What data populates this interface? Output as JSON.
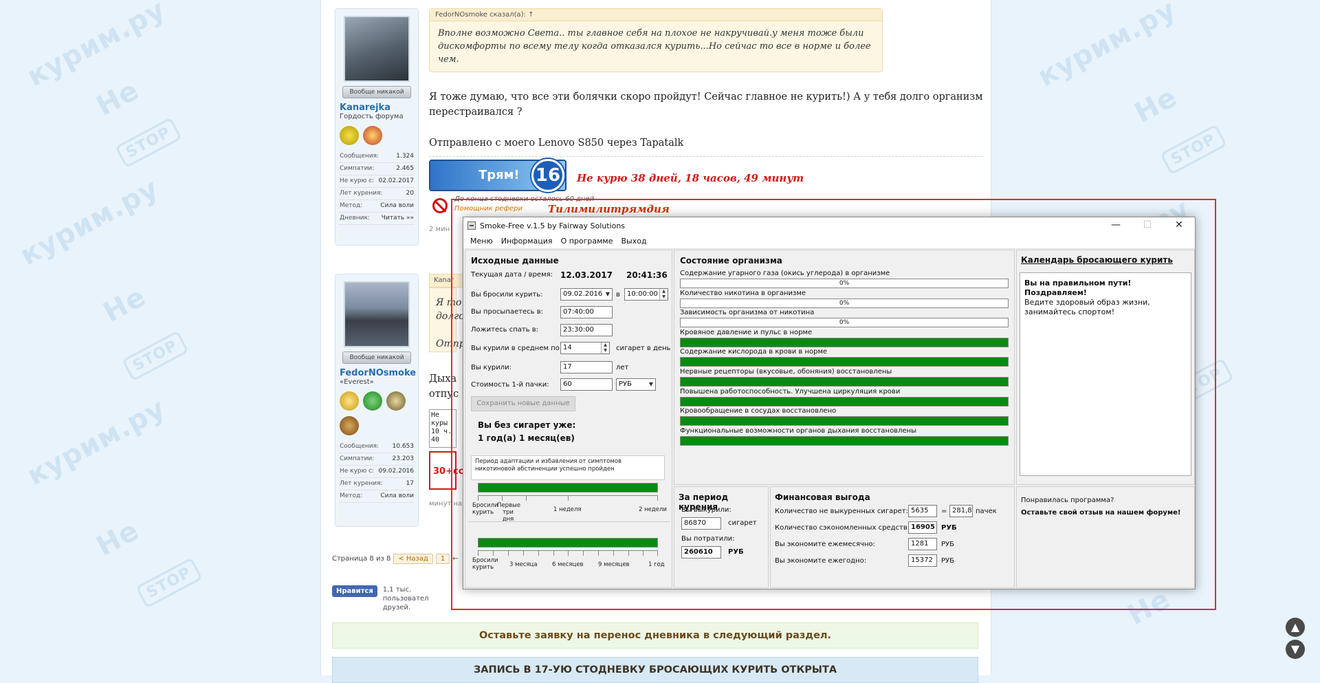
{
  "forum": {
    "post1": {
      "user_name": "Kanarejka",
      "user_title": "Гордость форума",
      "status_button": "Вообще никакой",
      "stats": [
        {
          "label": "Сообщения:",
          "value": "1.324"
        },
        {
          "label": "Симпатии:",
          "value": "2.465"
        },
        {
          "label": "Не курю с:",
          "value": "02.02.2017"
        },
        {
          "label": "Лет курения:",
          "value": "20"
        },
        {
          "label": "Метод:",
          "value": "Сила воли"
        },
        {
          "label": "Дневник:",
          "value": "Читать »»"
        }
      ],
      "quote_head": "FedorNOsmoke сказал(а): ↑",
      "quote_text": "Вполне возможно Света.. ты главное себя на плохое не накручивай.у меня тоже были дискомфорты по всему телу когда отказался курить...Но сейчас то все в норме и более чем.",
      "text": "Я тоже думаю, что все эти болячки скоро пройдут! Сейчас главное не курить!) А у тебя долго организм перестраивался ?",
      "sent_from": "Отправлено с моего Lenovo S850 через Tapatalk",
      "sig_banner": "Трям!",
      "sig_badge": "16",
      "sig_text": "Не курю  38 дней, 18 часов, 49 минут",
      "sig_line2": "До конца стодневки осталось 60 дней",
      "sig_line3": "Помощник рефери",
      "sig_line4": "Тилимилитрямдия",
      "time_ago": "2 мин"
    },
    "post2": {
      "user_name": "FedorNOsmoke",
      "user_title": "«Everest»",
      "status_button": "Вообще никакой",
      "stats": [
        {
          "label": "Сообщения:",
          "value": "10.653"
        },
        {
          "label": "Симпатии:",
          "value": "23.203"
        },
        {
          "label": "Не курю с:",
          "value": "09.02.2016"
        },
        {
          "label": "Лет курения:",
          "value": "17"
        },
        {
          "label": "Метод:",
          "value": "Сила воли"
        }
      ],
      "quote_head": "Kanar",
      "quote_line1": "Я то",
      "quote_line2": "долго",
      "quote_line3": "Отпр",
      "text_line1": "Дыха",
      "text_line2": "отпус",
      "box_line1": "Не куры",
      "box_line2": "10 ч. 40",
      "red_box": "30+сс",
      "time_ago": "минут на"
    },
    "pager": {
      "label": "Страница 8 из 8",
      "prev": "< Назад",
      "page": "1",
      "arrow": "←"
    },
    "facebook": {
      "button": "Нравится",
      "text": "1,1 тыс. пользовател друзей."
    },
    "green_banner": "Оставьте заявку на перенос дневника в следующий раздел.",
    "blue_banner": "ЗАПИСЬ В 17-УЮ СТОДНЕВКУ БРОСАЮЩИХ КУРИТЬ ОТКРЫТА",
    "watermark_words": [
      "Не",
      "курим.ру",
      "STOP"
    ]
  },
  "app": {
    "title": "Smoke-Free v.1.5 by Fairway Solutions",
    "controls": {
      "minimize": "—",
      "maximize": "☐",
      "close": "✕"
    },
    "menu": [
      "Меню",
      "Информация",
      "О программе",
      "Выход"
    ],
    "source": {
      "title": "Исходные данные",
      "current_label": "Текущая дата / время:",
      "current_date": "12.03.2017",
      "current_time": "20:41:36",
      "quit_label": "Вы бросили курить:",
      "quit_date": "09.02.2016",
      "quit_in": "в",
      "quit_time": "10:00:00",
      "wake_label": "Вы просыпаетесь в:",
      "wake_value": "07:40:00",
      "sleep_label": "Ложитесь спать в:",
      "sleep_value": "23:30:00",
      "avg_label": "Вы курили в среднем по:",
      "avg_value": "14",
      "avg_unit": "сигарет в день",
      "years_label": "Вы курили:",
      "years_value": "17",
      "years_unit": "лет",
      "price_label": "Стоимость 1-й пачки:",
      "price_value": "60",
      "currency": "РУБ",
      "save_button": "Сохранить новые данные",
      "without_label": "Вы без сигарет уже:",
      "without_value": "1 год(а)  1 месяц(ев)",
      "adapt_text": "Период адаптации и избавления от симптомов никотиновой абстиненции успешно пройден",
      "adapt_progress": 1.0,
      "scale1": [
        "Бросили курить",
        "Первые три дня",
        "1 неделя",
        "2 недели"
      ],
      "long_progress": 1.0,
      "scale2": [
        "Бросили курить",
        "3 месяца",
        "6 месяцев",
        "9 месяцев",
        "1 год"
      ]
    },
    "health": {
      "title": "Состояние организма",
      "items": [
        {
          "label": "Содержание угарного газа (окись углерода) в организме",
          "progress": 0,
          "text": "0%"
        },
        {
          "label": "Количество никотина в организме",
          "progress": 0,
          "text": "0%"
        },
        {
          "label": "Зависимость организма от никотина",
          "progress": 0,
          "text": "0%"
        },
        {
          "label": "Кровяное давление и пульс в норме",
          "progress": 1,
          "text": ""
        },
        {
          "label": "Содержание кислорода в крови в норме",
          "progress": 1,
          "text": ""
        },
        {
          "label": "Нервные рецепторы (вкусовые, обоняния) восстановлены",
          "progress": 1,
          "text": ""
        },
        {
          "label": "Повышена работоспособность. Улучшена циркуляция крови",
          "progress": 1,
          "text": ""
        },
        {
          "label": "Кровообращение в сосудах восстановлено",
          "progress": 1,
          "text": ""
        },
        {
          "label": "Функциональные возможности органов дыхания восстановлены",
          "progress": 1,
          "text": ""
        }
      ]
    },
    "calendar": {
      "link": "Календарь бросающего курить",
      "line1": "Вы на правильном пути!",
      "line2": "Поздравляем!",
      "line3": "Ведите здоровый образ жизни, занимайтесь спортом!"
    },
    "period": {
      "title": "За период курения",
      "smoked_label": "Вы выкурили:",
      "smoked_value": "86870",
      "smoked_unit": "сигарет",
      "spent_label": "Вы потратили:",
      "spent_value": "260610",
      "spent_unit": "РУБ"
    },
    "finance": {
      "title": "Финансовая выгода",
      "not_smoked_label": "Количество не выкуренных сигарет:",
      "not_smoked_value": "5635",
      "eq": "=",
      "packs_value": "281,8",
      "packs_unit": "пачек",
      "saved_label": "Количество сэкономленных средств:",
      "saved_value": "16905",
      "monthly_label": "Вы экономите ежемесячно:",
      "monthly_value": "1281",
      "yearly_label": "Вы экономите ежегодно:",
      "yearly_value": "15372",
      "currency": "РУБ"
    },
    "feedback": {
      "line1": "Понравилась программа?",
      "line2": "Оставьте свой отзыв на нашем форуме!"
    }
  }
}
